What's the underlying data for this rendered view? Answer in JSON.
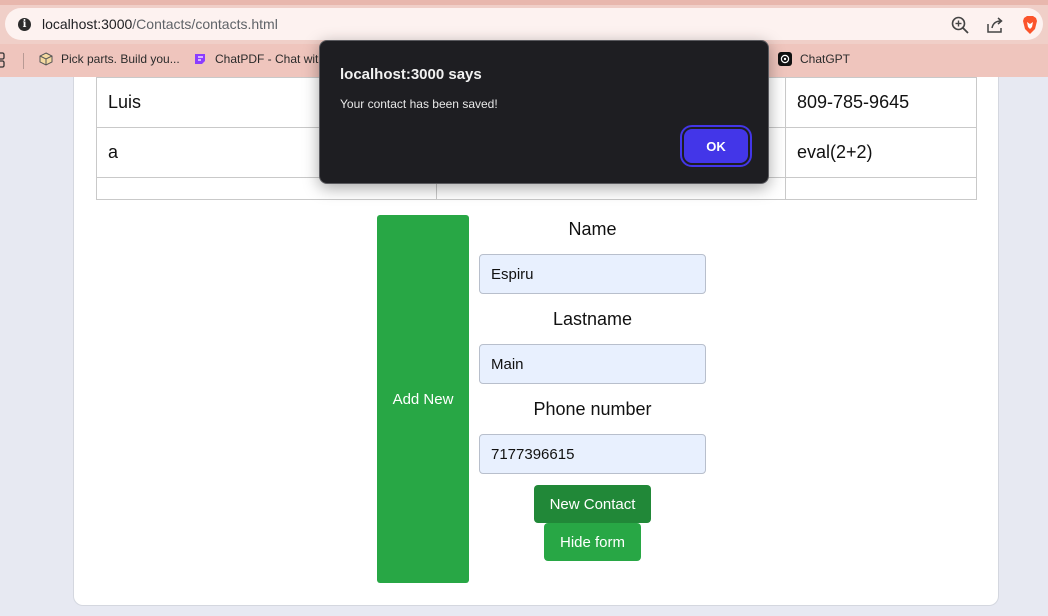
{
  "browser": {
    "url_host": "localhost:3000",
    "url_path": "/Contacts/contacts.html",
    "accent_color": "#f0cfc8"
  },
  "bookmarks": {
    "items": [
      {
        "label": "Pick parts. Build you...",
        "icon": "box-icon"
      },
      {
        "label": "ChatPDF - Chat with",
        "icon": "chatpdf-icon"
      },
      {
        "label": "ChatGPT",
        "icon": "openai-icon"
      }
    ]
  },
  "table": {
    "rows": [
      {
        "c1": "Luis",
        "c2": "",
        "c3": "809-785-9645"
      },
      {
        "c1": "a",
        "c2": "",
        "c3": "eval(2+2)"
      },
      {
        "c1": "",
        "c2": "",
        "c3": ""
      }
    ]
  },
  "form": {
    "add_new_label": "Add New",
    "name_label": "Name",
    "name_value": "Espiru",
    "lastname_label": "Lastname",
    "lastname_value": "Main",
    "phone_label": "Phone number",
    "phone_value": "7177396615",
    "new_contact_label": "New Contact",
    "hide_form_label": "Hide form",
    "button_color": "#28a745"
  },
  "dialog": {
    "title": "localhost:3000 says",
    "message": "Your contact has been saved!",
    "ok_label": "OK",
    "ok_color": "#4336e8"
  }
}
